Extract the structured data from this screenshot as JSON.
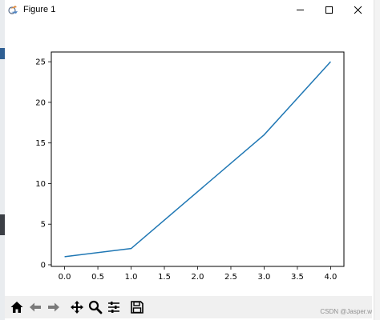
{
  "window": {
    "title": "Figure 1",
    "controls": [
      "minimize",
      "maximize",
      "close"
    ]
  },
  "toolbar": {
    "buttons": [
      "home-icon",
      "back-icon",
      "forward-icon",
      "pan-icon",
      "zoom-icon",
      "configure-subplots-icon",
      "save-icon"
    ]
  },
  "watermark": "CSDN @Jasper.w",
  "chart_data": {
    "type": "line",
    "x": [
      0.0,
      1.0,
      3.0,
      4.0
    ],
    "series": [
      {
        "values": [
          1,
          2,
          16,
          25
        ],
        "color": "#1f77b4"
      }
    ],
    "xlim": [
      -0.2,
      4.2
    ],
    "ylim": [
      -0.2,
      26.2
    ],
    "xticks": [
      "0.0",
      "0.5",
      "1.0",
      "1.5",
      "2.0",
      "2.5",
      "3.0",
      "3.5",
      "4.0"
    ],
    "yticks": [
      "0",
      "5",
      "10",
      "15",
      "20",
      "25"
    ],
    "grid": false
  }
}
